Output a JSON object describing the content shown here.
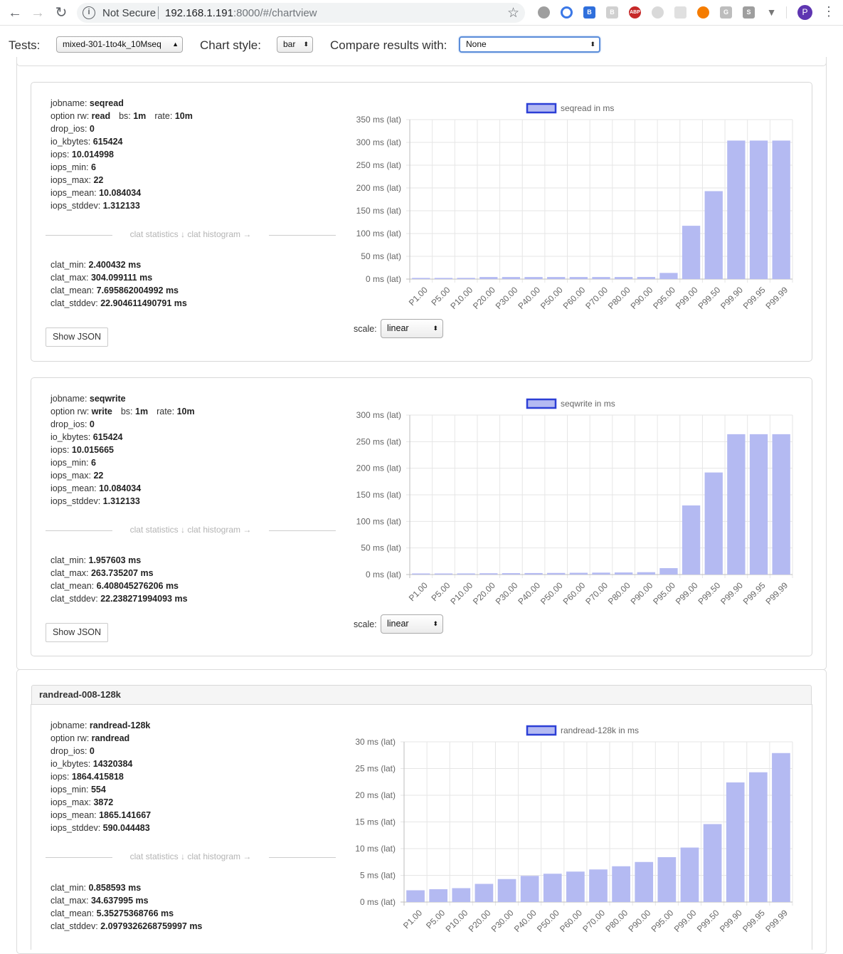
{
  "browser": {
    "security_label": "Not Secure",
    "url_host": "192.168.1.191",
    "url_path": ":8000/#/chartview",
    "avatar_letter": "P"
  },
  "toolbar": {
    "tests_label": "Tests:",
    "tests_value": "mixed-301-1to4k_10Mseq",
    "chart_style_label": "Chart style:",
    "chart_style_value": "bar",
    "compare_label": "Compare results with:",
    "compare_value": "None"
  },
  "common": {
    "divider_text": "clat statistics ↓ clat histogram →",
    "show_json": "Show JSON",
    "scale_label": "scale:",
    "scale_value": "linear"
  },
  "group2": {
    "title": "randread-008-128k"
  },
  "jobs": [
    {
      "jobname": "seqread",
      "rw": "read",
      "bs": "1m",
      "rate": "10m",
      "drop_ios": "0",
      "io_kbytes": "615424",
      "iops": "10.014998",
      "iops_min": "6",
      "iops_max": "22",
      "iops_mean": "10.084034",
      "iops_stddev": "1.312133",
      "clat_min": "2.400432 ms",
      "clat_max": "304.099111 ms",
      "clat_mean": "7.695862004992 ms",
      "clat_stddev": "22.904611490791 ms"
    },
    {
      "jobname": "seqwrite",
      "rw": "write",
      "bs": "1m",
      "rate": "10m",
      "drop_ios": "0",
      "io_kbytes": "615424",
      "iops": "10.015665",
      "iops_min": "6",
      "iops_max": "22",
      "iops_mean": "10.084034",
      "iops_stddev": "1.312133",
      "clat_min": "1.957603 ms",
      "clat_max": "263.735207 ms",
      "clat_mean": "6.408045276206 ms",
      "clat_stddev": "22.238271994093 ms"
    },
    {
      "jobname": "randread-128k",
      "rw": "randread",
      "drop_ios": "0",
      "io_kbytes": "14320384",
      "iops": "1864.415818",
      "iops_min": "554",
      "iops_max": "3872",
      "iops_mean": "1865.141667",
      "iops_stddev": "590.044483",
      "clat_min": "0.858593 ms",
      "clat_max": "34.637995 ms",
      "clat_mean": "5.35275368766 ms",
      "clat_stddev": "2.0979326268759997 ms"
    }
  ],
  "chart_data": [
    {
      "type": "bar",
      "legend": "seqread in ms",
      "categories": [
        "P1.00",
        "P5.00",
        "P10.00",
        "P20.00",
        "P30.00",
        "P40.00",
        "P50.00",
        "P60.00",
        "P70.00",
        "P80.00",
        "P90.00",
        "P95.00",
        "P99.00",
        "P99.50",
        "P99.90",
        "P99.95",
        "P99.99"
      ],
      "values": [
        2.5,
        2.5,
        2.6,
        4.5,
        4.5,
        4.5,
        4.5,
        4.5,
        4.5,
        4.5,
        4.6,
        13.5,
        117,
        193,
        304,
        304,
        304
      ],
      "ylim": [
        0,
        350
      ],
      "yticks": [
        "0 ms (lat)",
        "50 ms (lat)",
        "100 ms (lat)",
        "150 ms (lat)",
        "200 ms (lat)",
        "250 ms (lat)",
        "300 ms (lat)",
        "350 ms (lat)"
      ],
      "color": "#b4baf2",
      "legend_border": "#2c3fd6"
    },
    {
      "type": "bar",
      "legend": "seqwrite in ms",
      "categories": [
        "P1.00",
        "P5.00",
        "P10.00",
        "P20.00",
        "P30.00",
        "P40.00",
        "P50.00",
        "P60.00",
        "P70.00",
        "P80.00",
        "P90.00",
        "P95.00",
        "P99.00",
        "P99.50",
        "P99.90",
        "P99.95",
        "P99.99"
      ],
      "values": [
        2.0,
        2.0,
        2.1,
        2.4,
        2.6,
        2.8,
        3.0,
        3.3,
        3.6,
        3.9,
        4.4,
        12,
        130,
        192,
        264,
        264,
        264
      ],
      "ylim": [
        0,
        300
      ],
      "yticks": [
        "0 ms (lat)",
        "50 ms (lat)",
        "100 ms (lat)",
        "150 ms (lat)",
        "200 ms (lat)",
        "250 ms (lat)",
        "300 ms (lat)"
      ],
      "color": "#b4baf2",
      "legend_border": "#2c3fd6"
    },
    {
      "type": "bar",
      "legend": "randread-128k in ms",
      "categories": [
        "P1.00",
        "P5.00",
        "P10.00",
        "P20.00",
        "P30.00",
        "P40.00",
        "P50.00",
        "P60.00",
        "P70.00",
        "P80.00",
        "P90.00",
        "P95.00",
        "P99.00",
        "P99.50",
        "P99.90",
        "P99.95",
        "P99.99"
      ],
      "values": [
        2.2,
        2.4,
        2.6,
        3.4,
        4.3,
        4.9,
        5.3,
        5.7,
        6.1,
        6.7,
        7.5,
        8.4,
        10.2,
        14.6,
        22.4,
        24.3,
        27.9
      ],
      "ylim": [
        0,
        30
      ],
      "yticks": [
        "0 ms (lat)",
        "5 ms (lat)",
        "10 ms (lat)",
        "15 ms (lat)",
        "20 ms (lat)",
        "25 ms (lat)",
        "30 ms (lat)"
      ],
      "color": "#b4baf2",
      "legend_border": "#2c3fd6"
    }
  ]
}
